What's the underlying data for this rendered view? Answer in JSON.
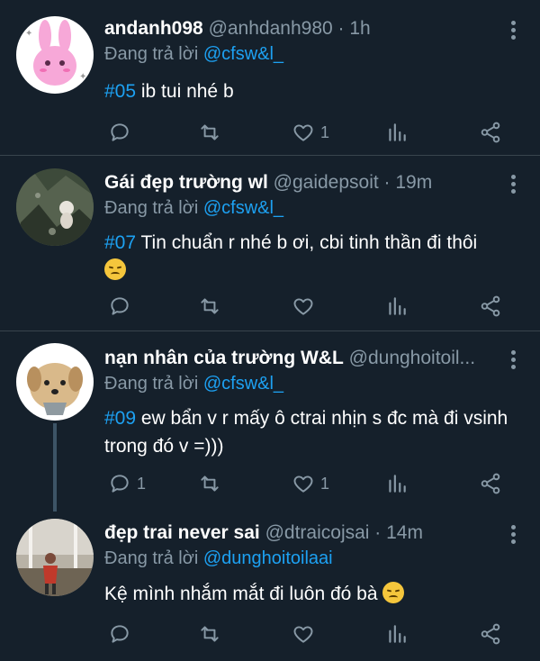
{
  "reply_prefix": "Đang trả lời",
  "tweets": [
    {
      "name": "andanh098",
      "meta": "@anhdanh980 · 1h",
      "replying_to": "@cfsw&l_",
      "hashtag": "#05",
      "text": " ib tui nhé b",
      "reply_count": "",
      "like_count": "1"
    },
    {
      "name": "Gái đẹp trường wl",
      "meta": "@gaidepsoit · 19m",
      "replying_to": "@cfsw&l_",
      "hashtag": "#07",
      "text": " Tin chuẩn r nhé b ơi, cbi tinh thần đi thôi",
      "emoji": "disappointed-face",
      "reply_count": "",
      "like_count": ""
    },
    {
      "name": "nạn nhân của trường W&L",
      "meta": "@dunghoitoil...",
      "replying_to": "@cfsw&l_",
      "hashtag": "#09",
      "text": " ew bẩn v r mấy ô ctrai nhịn s đc mà đi vsinh trong đó v =)))",
      "reply_count": "1",
      "like_count": "1"
    },
    {
      "name": "đẹp trai never sai",
      "meta": "@dtraicojsai · 14m",
      "replying_to": "@dunghoitoilaai",
      "hashtag": "",
      "text": "Kệ mình nhắm mắt đi luôn đó bà ",
      "emoji": "pensive-face",
      "reply_count": "",
      "like_count": ""
    }
  ],
  "colors": {
    "background": "#15202b",
    "secondary_text": "#8899a6",
    "accent": "#1da1f2",
    "divider": "#38444d"
  }
}
